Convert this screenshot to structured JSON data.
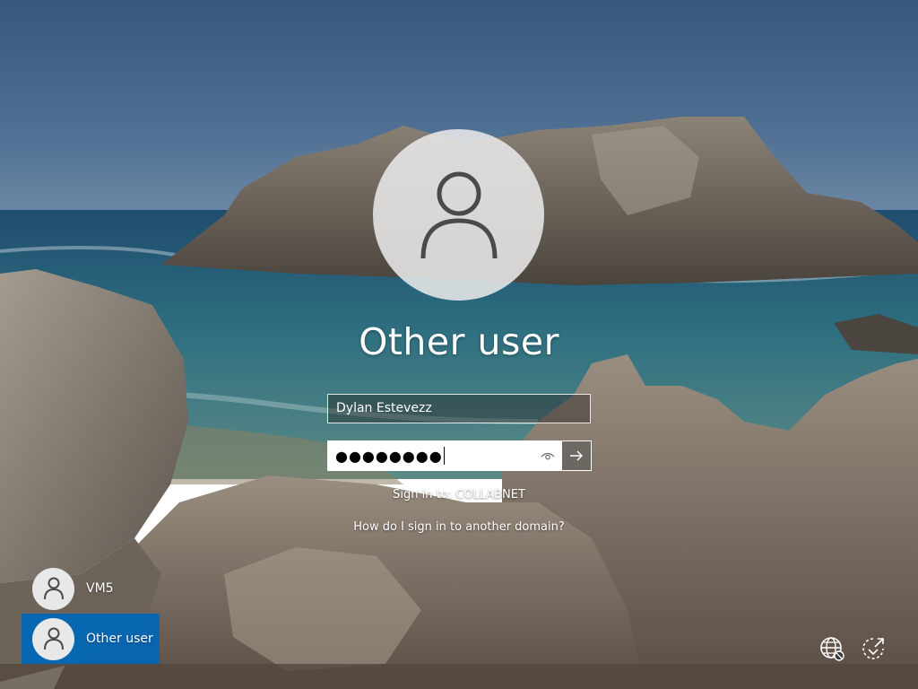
{
  "login": {
    "display_name": "Other user",
    "username_value": "Dylan Estevezz",
    "password_masked": "●●●●●●●●",
    "sign_in_to": "Sign in to: COLLABNET",
    "other_domain_link": "How do I sign in to another domain?"
  },
  "user_list": {
    "items": [
      {
        "label": "VM5",
        "selected": false,
        "icon": "user-icon"
      },
      {
        "label": "Other user",
        "selected": true,
        "icon": "user-icon"
      }
    ]
  },
  "tray": {
    "network_icon": "globe-network-icon",
    "accessibility_icon": "ease-of-access-icon"
  },
  "colors": {
    "selected_user": "#0067B8",
    "text": "#FFFFFF",
    "avatar_bg": "#E8E8E8",
    "avatar_fg": "#4A4A4A"
  }
}
